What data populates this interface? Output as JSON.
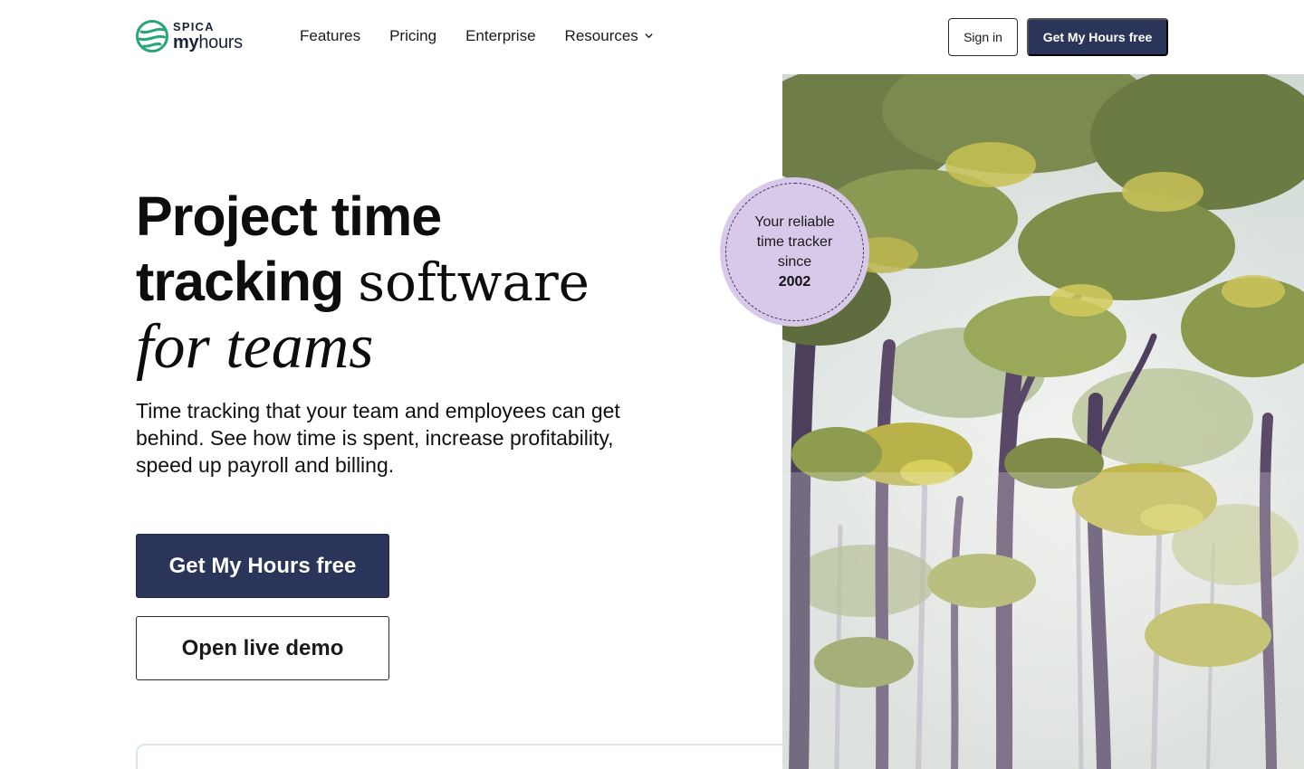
{
  "brand": {
    "company": "SPICA",
    "product_bold": "my",
    "product_light": "hours",
    "accent_green": "#27a67a",
    "navy": "#2b3559"
  },
  "nav": {
    "items": [
      {
        "label": "Features"
      },
      {
        "label": "Pricing"
      },
      {
        "label": "Enterprise"
      },
      {
        "label": "Resources",
        "icon": "chevron-down-icon"
      }
    ]
  },
  "header": {
    "signin_label": "Sign in",
    "cta_label": "Get My Hours free"
  },
  "hero": {
    "title_bold_1": "Project time",
    "title_bold_2": "tracking",
    "title_serif": "software",
    "title_italic": "for teams",
    "subtitle": "Time tracking that your team and employees can get behind. See how time is spent, increase profitability, speed up payroll and billing.",
    "primary_cta": "Get My Hours free",
    "secondary_cta": "Open live demo"
  },
  "badge": {
    "text": "Your reliable time tracker since",
    "year": "2002",
    "color": "#d8c9ea"
  },
  "image": {
    "subject": "forest-painting"
  }
}
